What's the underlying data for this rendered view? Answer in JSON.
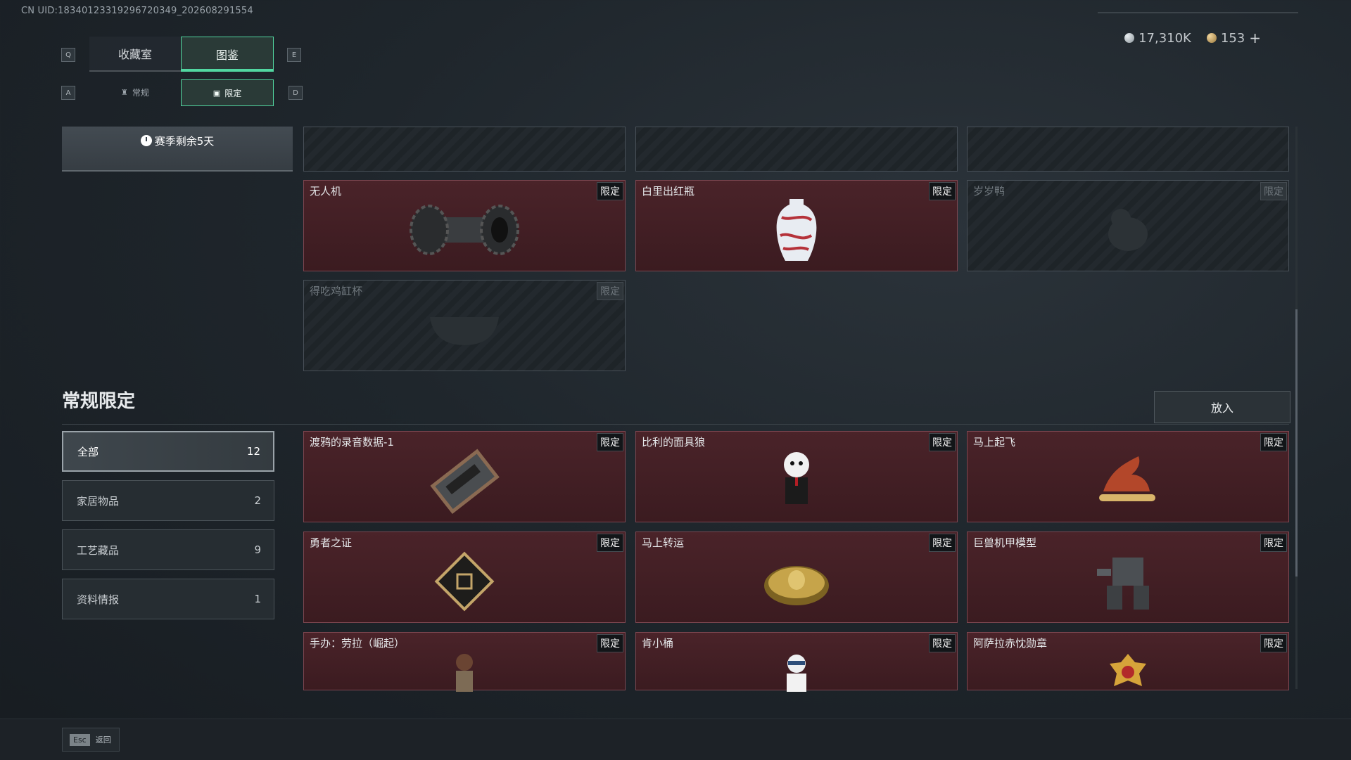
{
  "uid": "CN UID:18340123319296720349_202608291554",
  "keys": {
    "q": "Q",
    "e": "E",
    "a": "A",
    "d": "D"
  },
  "tabs": {
    "collection": "收藏室",
    "codex": "图鉴"
  },
  "subtabs": {
    "regular": "常规",
    "limited": "限定"
  },
  "currency": {
    "silver": "17,310K",
    "gold": "153",
    "plus": "+"
  },
  "season": {
    "label": "赛季剩余5天"
  },
  "top_grid": [
    {
      "name": "无人机",
      "badge": "限定",
      "locked": false,
      "icon": "drone-icon"
    },
    {
      "name": "白里出红瓶",
      "badge": "限定",
      "locked": false,
      "icon": "vase-icon"
    },
    {
      "name": "岁岁鸭",
      "badge": "限定",
      "locked": true,
      "icon": "duck-icon"
    },
    {
      "name": "得吃鸡缸杯",
      "badge": "限定",
      "locked": true,
      "icon": "cup-icon"
    }
  ],
  "section": {
    "title": "常规限定",
    "put_button": "放入"
  },
  "filters": [
    {
      "label": "全部",
      "count": "12"
    },
    {
      "label": "家居物品",
      "count": "2"
    },
    {
      "label": "工艺藏品",
      "count": "9"
    },
    {
      "label": "资料情报",
      "count": "1"
    }
  ],
  "items": [
    {
      "name": "渡鸦的录音数据-1",
      "badge": "限定",
      "icon": "cassette-icon"
    },
    {
      "name": "比利的面具狼",
      "badge": "限定",
      "icon": "puppet-icon"
    },
    {
      "name": "马上起飞",
      "badge": "限定",
      "icon": "horse-icon"
    },
    {
      "name": "勇者之证",
      "badge": "限定",
      "icon": "card-icon"
    },
    {
      "name": "马上转运",
      "badge": "限定",
      "icon": "compass-icon"
    },
    {
      "name": "巨兽机甲模型",
      "badge": "限定",
      "icon": "mech-icon"
    },
    {
      "name": "手办：劳拉（崛起）",
      "badge": "限定",
      "icon": "figure-icon"
    },
    {
      "name": "肯小桶",
      "badge": "限定",
      "icon": "colonel-icon"
    },
    {
      "name": "阿萨拉赤忱勋章",
      "badge": "限定",
      "icon": "medal-icon"
    }
  ],
  "footer": {
    "esc_key": "Esc",
    "esc_label": "返回"
  }
}
